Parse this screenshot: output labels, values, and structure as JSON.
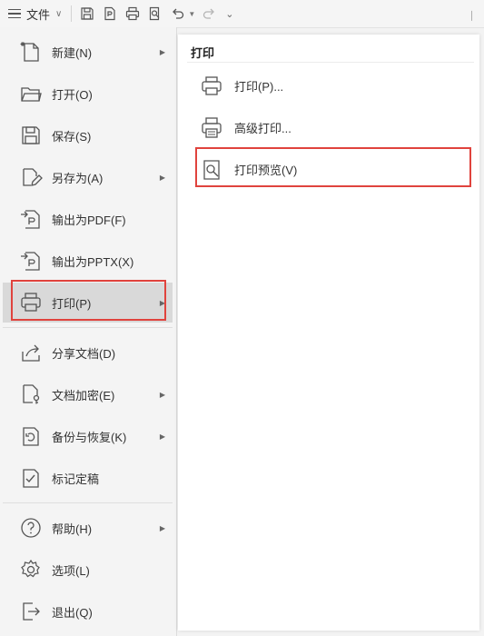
{
  "toolbar": {
    "file_label": "文件",
    "icons": [
      "menu-icon",
      "save-icon",
      "export-pdf-icon",
      "print-icon",
      "print-preview-icon",
      "undo-icon",
      "redo-icon",
      "more-icon"
    ]
  },
  "menu": {
    "items": [
      {
        "label": "新建(N)",
        "icon": "new-file-icon",
        "submenu": true
      },
      {
        "label": "打开(O)",
        "icon": "folder-open-icon",
        "submenu": false
      },
      {
        "label": "保存(S)",
        "icon": "save-icon",
        "submenu": false
      },
      {
        "label": "另存为(A)",
        "icon": "save-as-icon",
        "submenu": true
      },
      {
        "label": "输出为PDF(F)",
        "icon": "export-pdf-icon",
        "submenu": false
      },
      {
        "label": "输出为PPTX(X)",
        "icon": "export-pptx-icon",
        "submenu": false
      },
      {
        "label": "打印(P)",
        "icon": "print-icon",
        "submenu": true,
        "active": true
      },
      {
        "label": "分享文档(D)",
        "icon": "share-icon",
        "submenu": false
      },
      {
        "label": "文档加密(E)",
        "icon": "encrypt-icon",
        "submenu": true
      },
      {
        "label": "备份与恢复(K)",
        "icon": "backup-icon",
        "submenu": true
      },
      {
        "label": "标记定稿",
        "icon": "finalize-icon",
        "submenu": false
      },
      {
        "label": "帮助(H)",
        "icon": "help-icon",
        "submenu": true
      },
      {
        "label": "选项(L)",
        "icon": "settings-icon",
        "submenu": false
      },
      {
        "label": "退出(Q)",
        "icon": "exit-icon",
        "submenu": false
      }
    ]
  },
  "print_panel": {
    "title": "打印",
    "items": [
      {
        "label": "打印(P)...",
        "icon": "printer-icon"
      },
      {
        "label": "高级打印...",
        "icon": "advanced-print-icon"
      },
      {
        "label": "打印预览(V)",
        "icon": "print-preview-icon"
      }
    ]
  },
  "colors": {
    "highlight": "#e0433d",
    "active_bg": "#d9d9d9",
    "menu_bg": "#f4f4f4",
    "panel_bg": "#ffffff"
  }
}
